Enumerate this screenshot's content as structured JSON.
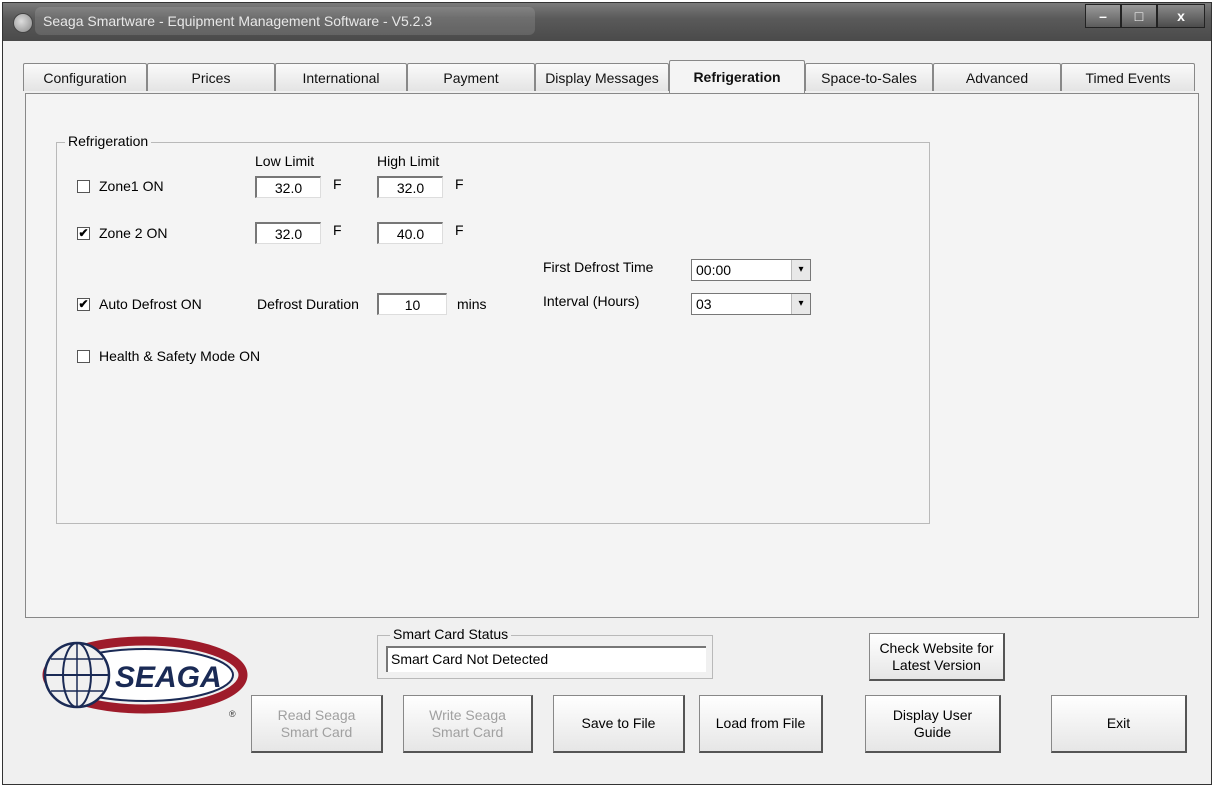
{
  "window": {
    "title": "Seaga Smartware - Equipment Management Software - V5.2.3"
  },
  "titlebar_buttons": {
    "minimize": "–",
    "maximize": "□",
    "close": "x"
  },
  "tabs": [
    {
      "label": "Configuration"
    },
    {
      "label": "Prices"
    },
    {
      "label": "International"
    },
    {
      "label": "Payment"
    },
    {
      "label": "Display Messages"
    },
    {
      "label": "Refrigeration"
    },
    {
      "label": "Space-to-Sales"
    },
    {
      "label": "Advanced"
    },
    {
      "label": "Timed Events"
    }
  ],
  "active_tab": "Refrigeration",
  "refrigeration": {
    "group_title": "Refrigeration",
    "low_limit_label": "Low Limit",
    "high_limit_label": "High Limit",
    "unit": "F",
    "zone1": {
      "label": "Zone1 ON",
      "checked": false,
      "check_mark": "",
      "low": "32.0",
      "high": "32.0"
    },
    "zone2": {
      "label": "Zone 2 ON",
      "checked": true,
      "check_mark": "✔",
      "low": "32.0",
      "high": "40.0"
    },
    "auto_defrost": {
      "label": "Auto Defrost ON",
      "checked": true,
      "check_mark": "✔"
    },
    "defrost_duration_label": "Defrost Duration",
    "defrost_duration_value": "10",
    "defrost_duration_unit": "mins",
    "first_defrost_label": "First Defrost Time",
    "first_defrost_value": "00:00",
    "interval_label": "Interval (Hours)",
    "interval_value": "03",
    "health_safety": {
      "label": "Health & Safety Mode ON",
      "checked": false,
      "check_mark": ""
    }
  },
  "smart_card": {
    "group_title": "Smart Card Status",
    "status": "Smart Card Not Detected"
  },
  "buttons": {
    "check_website": "Check Website for\nLatest Version",
    "read_card": "Read Seaga\nSmart Card",
    "write_card": "Write Seaga\nSmart Card",
    "save_file": "Save to File",
    "load_file": "Load from File",
    "user_guide": "Display User\nGuide",
    "exit": "Exit"
  },
  "logo": {
    "text": "SEAGA",
    "mark": "®"
  },
  "colors": {
    "logo_red": "#9e1b2a",
    "logo_navy": "#1a2a55"
  },
  "icons": {
    "dropdown": "▾"
  }
}
